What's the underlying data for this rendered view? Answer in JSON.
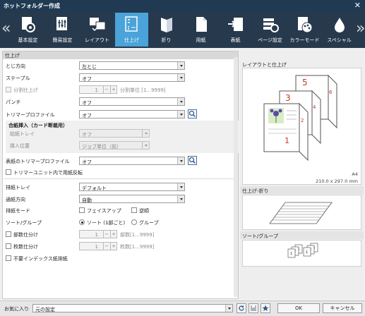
{
  "window": {
    "title": "ホットフォルダー作成",
    "close": "✕"
  },
  "ribbon": {
    "prev": "«",
    "next": "»",
    "tabs": [
      {
        "label": "基本設定",
        "icon": "basic-settings-icon"
      },
      {
        "label": "簡易設定",
        "icon": "easy-settings-icon"
      },
      {
        "label": "レイアウト",
        "icon": "layout-icon"
      },
      {
        "label": "仕上げ",
        "icon": "finishing-icon",
        "selected": true
      },
      {
        "label": "折り",
        "icon": "fold-icon"
      },
      {
        "label": "用紙",
        "icon": "paper-icon"
      },
      {
        "label": "表紙",
        "icon": "cover-icon"
      },
      {
        "label": "ページ設定",
        "icon": "page-settings-icon"
      },
      {
        "label": "カラーモード",
        "icon": "color-mode-icon"
      },
      {
        "label": "スペシャル",
        "icon": "special-icon"
      }
    ]
  },
  "finish": {
    "section": "仕上げ",
    "binding": {
      "label": "とじ方向",
      "value": "左とじ"
    },
    "staple": {
      "label": "ステープル",
      "value": "オフ"
    },
    "split": {
      "label": "分割仕上げ",
      "value": "1",
      "unit": "分割単位 [1...9999]"
    },
    "punch": {
      "label": "パンチ",
      "value": "オフ"
    },
    "trim": {
      "label": "トリマープロファイル",
      "value": "オフ"
    },
    "insert": {
      "title": "合紙挿入（カード断裁用）",
      "tray_label": "給紙トレイ",
      "tray_value": "オフ",
      "pos_label": "挿入位置",
      "pos_value": "ジョブ単位（前）"
    },
    "cover_trim": {
      "label": "表紙のトリマープロファイル",
      "value": "オフ"
    },
    "flip": {
      "label": "トリマーユニット内で用紙反転"
    },
    "out_tray": {
      "label": "排紙トレイ",
      "value": "デフォルト"
    },
    "feed_dir": {
      "label": "通紙方向",
      "value": "自動"
    },
    "out_mode": {
      "label": "排紙モード",
      "face_up": "フェイスアップ",
      "reverse": "逆順"
    },
    "sort": {
      "label": "ソート/グループ",
      "sort": "ソート (1部ごと)",
      "group": "グループ"
    },
    "copies": {
      "label": "部数仕分け",
      "value": "1",
      "unit": "部数[1...9999]"
    },
    "sheets": {
      "label": "枚数仕分け",
      "value": "1",
      "unit": "枚数[1...9999]"
    },
    "no_index": {
      "label": "不要インデックス紙排紙"
    }
  },
  "spin": {
    "minus": "−",
    "plus": "+"
  },
  "preview": {
    "layout_title": "レイアウトと仕上げ",
    "pages": [
      "1",
      "3",
      "5",
      "2",
      "4",
      "6"
    ],
    "paper": "A4",
    "size": "210.0 x 297.0 mm",
    "fold_title": "仕上げ-折り",
    "sort_title": "ソート/グループ",
    "sort_nums": [
      "1",
      "2",
      "3"
    ]
  },
  "footer": {
    "fav_label": "お気に入り",
    "fav_value": "元の設定",
    "ok": "OK",
    "cancel": "キャンセル"
  },
  "colors": {
    "accent": "#4aa3d9",
    "ribbon": "#27394d",
    "title": "#1f3a52",
    "page_num": "#c0392b"
  }
}
